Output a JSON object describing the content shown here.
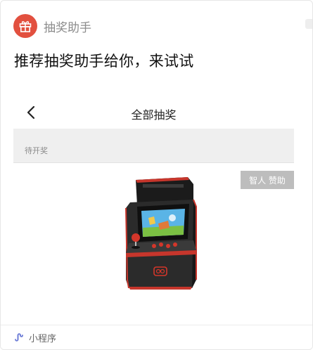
{
  "app": {
    "name": "抽奖助手",
    "logo_icon": "gift-icon",
    "logo_color": "#e2503f"
  },
  "share": {
    "title": "推荐抽奖助手给你，来试试"
  },
  "preview": {
    "nav_title": "全部抽奖",
    "back_icon": "chevron-left-icon",
    "filter_label": "待开奖",
    "sponsor_badge": "智人 赞助",
    "product_image": "arcade-machine-image"
  },
  "footer": {
    "icon": "mini-program-icon",
    "label": "小程序",
    "accent_color": "#6b7bd6"
  }
}
